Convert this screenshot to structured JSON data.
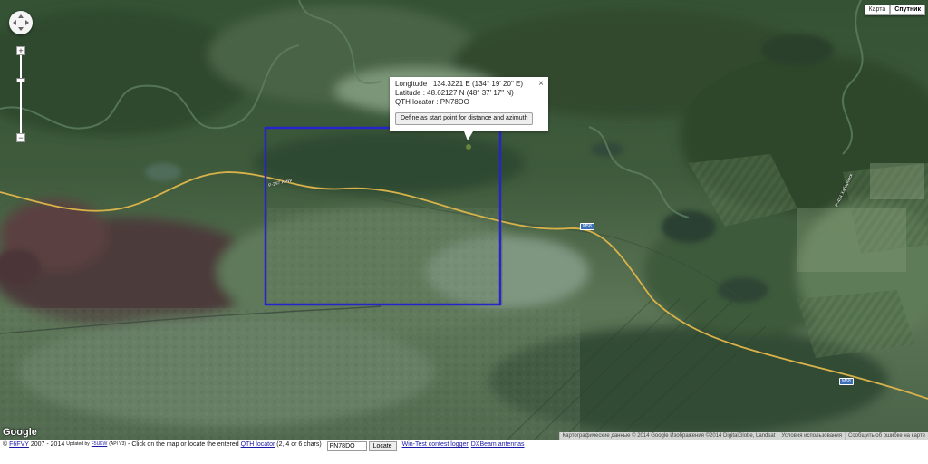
{
  "map": {
    "map_type_buttons": [
      "Карта",
      "Спутник"
    ],
    "active_map_type": "Спутник",
    "google_logo": "Google",
    "road_label": "Р-297 Амур",
    "road_label_2": "Р-454 Хабаровск",
    "highway_shield_1": "M58",
    "highway_shield_2": "M58",
    "attribution": "Картографические данные © 2014 Google Изображения ©2014 DigitalGlobe, Landsat",
    "terms_link": "Условия использования",
    "report_link": "Сообщить об ошибке на карте",
    "zoom_in": "+",
    "zoom_out": "−",
    "selection_rectangle_color": "#2525c8",
    "road_color": "#d9b24a"
  },
  "info_window": {
    "longitude": "Longitude : 134.3221 E (134° 19' 20\" E)",
    "latitude": "Latitude : 48.62127 N (48° 37' 17\" N)",
    "qth_locator": "QTH locator : PN78DO",
    "define_button": "Define as start point for distance and azimuth",
    "close": "×"
  },
  "footer": {
    "copyright_prefix": "©",
    "author_link": "F6FVY",
    "years": "2007 - 2014",
    "updated_by": "Updated by",
    "updater_link": "F5UKW",
    "api": "(API V3)",
    "instruction": "- Click on the map or locate the entered",
    "qth_link": "QTH locator",
    "chars": "(2, 4 or 6 chars) :",
    "locator_value": "PN78DO",
    "locate_button": "Locate",
    "wintest_link": "Win-Test contest logger",
    "dxbeam_link": "DXBeam antennas"
  }
}
